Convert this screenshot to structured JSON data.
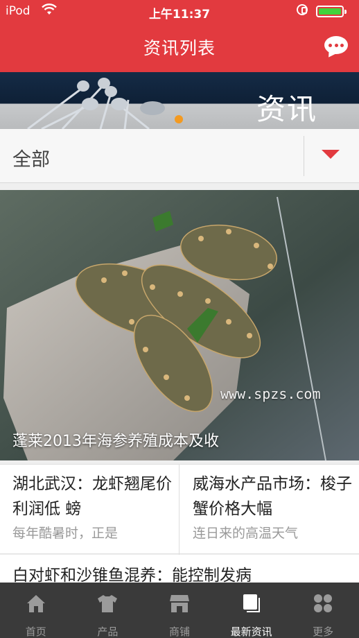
{
  "status": {
    "carrier": "iPod",
    "time": "上午11:37",
    "battery_level": 1.0,
    "battery_color": "#41d33c"
  },
  "header": {
    "title": "资讯列表",
    "accent": "#e23a3f"
  },
  "banner": {
    "text": "资讯"
  },
  "filter": {
    "selected": "全部"
  },
  "hero": {
    "caption": "蓬莱2013年海参养殖成本及收",
    "watermark": "www.spzs.com"
  },
  "cards": [
    {
      "title": "湖北武汉：龙虾翘尾价利润低 螃",
      "summary": "每年酷暑时，正是"
    },
    {
      "title": "威海水产品市场：梭子蟹价格大幅",
      "summary": "连日来的高温天气"
    }
  ],
  "list": [
    {
      "title": "白对虾和沙锥鱼混养：能控制发病"
    }
  ],
  "tabs": [
    {
      "label": "首页",
      "icon": "home-icon"
    },
    {
      "label": "产品",
      "icon": "tshirt-icon"
    },
    {
      "label": "商铺",
      "icon": "store-icon"
    },
    {
      "label": "最新资讯",
      "icon": "news-icon",
      "active": true
    },
    {
      "label": "更多",
      "icon": "grid-icon"
    }
  ]
}
